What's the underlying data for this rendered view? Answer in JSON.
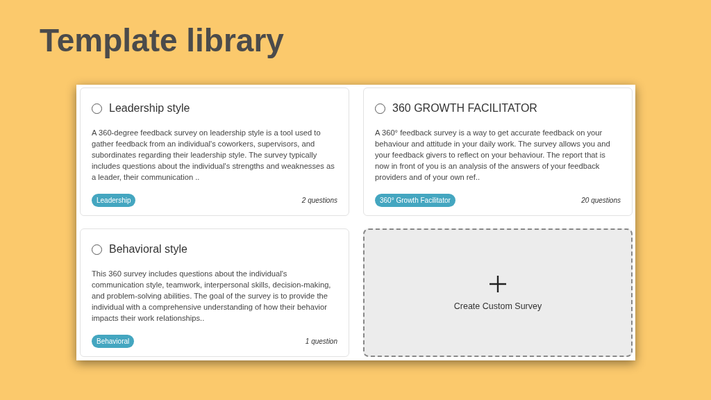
{
  "heading": "Template library",
  "templates": [
    {
      "title": "Leadership style",
      "selected": false,
      "description": "A 360-degree feedback survey on leadership style is a tool used to gather feedback from an individual's coworkers, supervisors, and subordinates regarding their leadership style. The survey typically includes questions about the individual's strengths and weaknesses as a leader, their communication ..",
      "tag": "Leadership",
      "count": "2 questions"
    },
    {
      "title": "360 GROWTH FACILITATOR",
      "selected": false,
      "description": "A 360° feedback survey is a way to get accurate feedback on your behaviour and attitude in your daily work. The survey allows you and your feedback givers to reflect on your behaviour. The report that is now in front of you is an analysis of the answers of your feedback providers and of your own ref..",
      "tag": "360° Growth Facilitator",
      "count": "20 questions"
    },
    {
      "title": "Behavioral style",
      "selected": false,
      "description": "This 360 survey includes questions about the individual's communication style, teamwork, interpersonal skills, decision-making, and problem-solving abilities. The goal of the survey is to provide the individual with a comprehensive understanding of how their behavior impacts their work relationships..",
      "tag": "Behavioral",
      "count": "1 question"
    }
  ],
  "custom_tile": {
    "label": "Create Custom Survey"
  }
}
